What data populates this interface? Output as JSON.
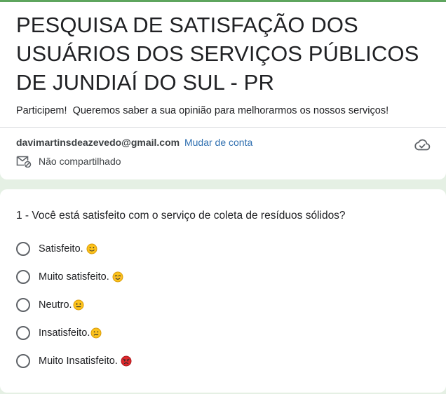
{
  "form": {
    "title": "PESQUISA DE SATISFAÇÃO DOS USUÁRIOS DOS SERVIÇOS PÚBLICOS DE JUNDIAÍ DO SUL - PR",
    "description": "Participem!  Queremos saber a sua opinião para melhorarmos os nossos serviços!"
  },
  "account": {
    "email": "davimartinsdeazevedo@gmail.com",
    "switch_label": "Mudar de conta",
    "share_status": "Não compartilhado",
    "icons": {
      "cloud": "cloud-check-icon",
      "mail": "mail-not-shared-icon"
    }
  },
  "question": {
    "title": "1 - Você está satisfeito com o serviço de coleta de resíduos sólidos?",
    "options": [
      {
        "label": "Satisfeito.",
        "emoji": "slightly-smiling-face-icon"
      },
      {
        "label": "Muito satisfeito.",
        "emoji": "smiling-face-icon"
      },
      {
        "label": "Neutro.",
        "emoji": "neutral-face-icon"
      },
      {
        "label": "Insatisfeito.",
        "emoji": "confused-face-icon"
      },
      {
        "label": "Muito Insatisfeito.",
        "emoji": "angry-face-icon"
      }
    ]
  },
  "colors": {
    "accent": "#5ea55e",
    "page_background": "#e5f0e4",
    "link": "#2f6fb0"
  }
}
